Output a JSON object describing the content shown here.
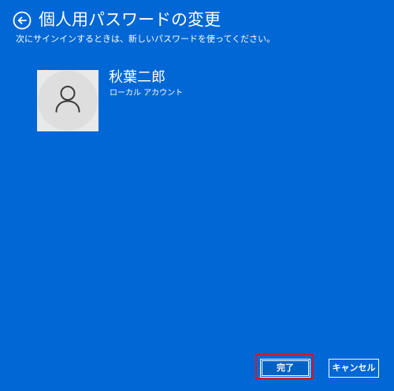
{
  "header": {
    "title": "個人用パスワードの変更",
    "back_icon": "back-arrow-icon"
  },
  "instruction": "次にサインインするときは、新しいパスワードを使ってください。",
  "account": {
    "name": "秋葉二郎",
    "type": "ローカル アカウント",
    "avatar_icon": "user-icon"
  },
  "buttons": {
    "finish_label": "完了",
    "cancel_label": "キャンセル"
  },
  "colors": {
    "background": "#0067d4",
    "text": "#ffffff",
    "avatar_background": "#e9e9e9",
    "highlight": "#cc1a2e"
  }
}
